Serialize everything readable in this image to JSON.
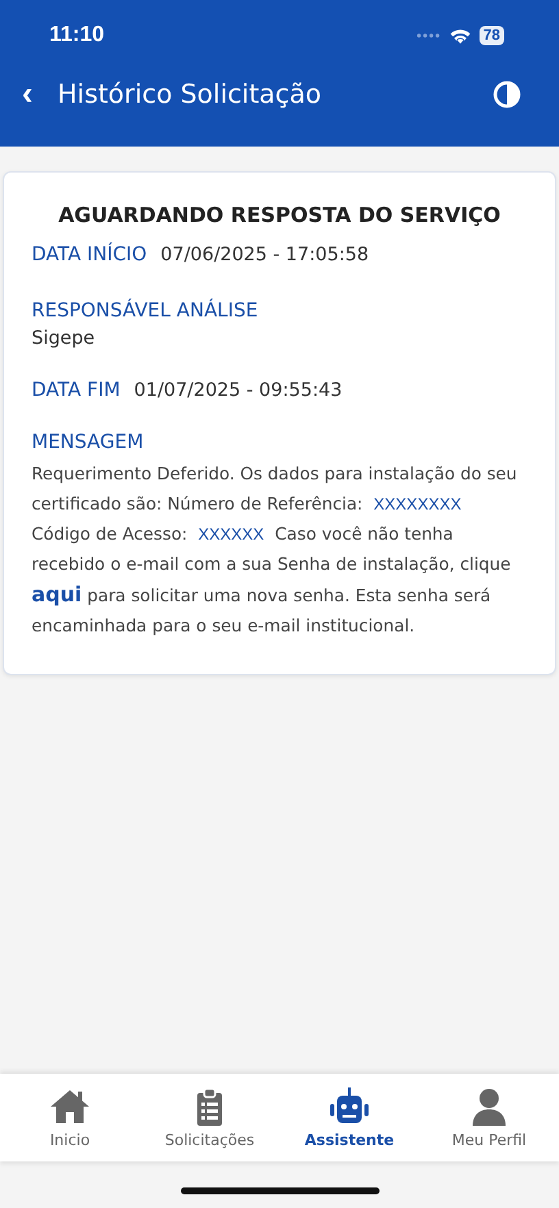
{
  "status_bar": {
    "time": "11:10",
    "battery": "78"
  },
  "header": {
    "back": "‹",
    "title": "Histórico Solicitação"
  },
  "card": {
    "title": "AGUARDANDO RESPOSTA DO SERVIÇO",
    "fields": [
      {
        "kind": "inline",
        "label": "DATA INÍCIO",
        "value": "07/06/2025 - 17:05:58"
      },
      {
        "kind": "stacked",
        "label": "RESPONSÁVEL ANÁLISE",
        "value": "Sigepe"
      },
      {
        "kind": "inline",
        "label": "DATA FIM",
        "value": "01/07/2025 - 09:55:43"
      }
    ],
    "message": {
      "label": "MENSAGEM",
      "segments": [
        {
          "kind": "text",
          "text": "Requerimento Deferido. Os dados para instalação do seu certificado são: Número de Referência: "
        },
        {
          "kind": "code",
          "text": "XXXXXXXX"
        },
        {
          "kind": "text",
          "text": " Código de Acesso: "
        },
        {
          "kind": "code",
          "text": "XXXXXX"
        },
        {
          "kind": "text",
          "text": " Caso você não tenha recebido o e-mail com a sua Senha de instalação, clique "
        },
        {
          "kind": "link",
          "text": "aqui"
        },
        {
          "kind": "text",
          "text": " para solicitar uma nova senha. Esta senha será encaminhada para o seu e-mail institucional."
        }
      ]
    }
  },
  "nav": [
    {
      "kind": "home",
      "label": "Inicio",
      "selected": false
    },
    {
      "kind": "clipboard",
      "label": "Solicitações",
      "selected": false
    },
    {
      "kind": "robot",
      "label": "Assistente",
      "selected": true
    },
    {
      "kind": "person",
      "label": "Meu Perfil",
      "selected": false
    }
  ]
}
